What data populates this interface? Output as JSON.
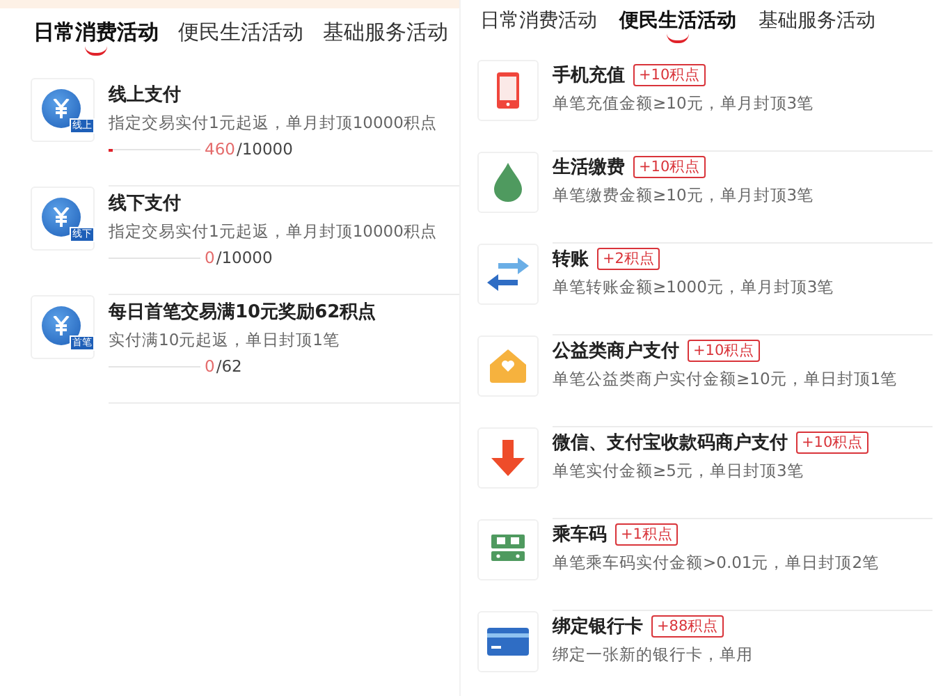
{
  "panels": [
    {
      "tabs": [
        {
          "label": "日常消费活动",
          "selected": true
        },
        {
          "label": "便民生活活动",
          "selected": false
        },
        {
          "label": "基础服务活动",
          "selected": false
        }
      ],
      "items": [
        {
          "kind": "progress",
          "tag": "线上",
          "title": "线上支付",
          "desc": "指定交易实付1元起返，单月封顶10000积点",
          "level": 0.046,
          "reading": "460",
          "limit": "/10000"
        },
        {
          "kind": "progress",
          "tag": "线下",
          "title": "线下支付",
          "desc": "指定交易实付1元起返，单月封顶10000积点",
          "reading": "0",
          "limit": "/10000"
        },
        {
          "kind": "progress",
          "tag": "首笔",
          "title": "每日首笔交易满10元奖励62积点",
          "desc": "实付满10元起返，单日封顶1笔",
          "reading": "0",
          "limit": "/62"
        }
      ]
    },
    {
      "tabs": [
        {
          "label": "日常消费活动",
          "selected": false
        },
        {
          "label": "便民生活活动",
          "selected": true
        },
        {
          "label": "基础服务活动",
          "selected": false
        }
      ],
      "items": [
        {
          "kind": "badge",
          "title": "手机充值",
          "badge": "+10积点",
          "desc": "单笔充值金额≥10元，单月封顶3笔"
        },
        {
          "kind": "badge",
          "title": "生活缴费",
          "badge": "+10积点",
          "desc": "单笔缴费金额≥10元，单月封顶3笔"
        },
        {
          "kind": "badge",
          "title": "转账",
          "badge": "+2积点",
          "desc": "单笔转账金额≥1000元，单月封顶3笔"
        },
        {
          "kind": "badge",
          "title": "公益类商户支付",
          "badge": "+10积点",
          "desc": "单笔公益类商户实付金额≥10元，单日封顶1笔"
        },
        {
          "kind": "badge",
          "title": "微信、支付宝收款码商户支付",
          "badge": "+10积点",
          "desc": "单笔实付金额≥5元，单日封顶3笔"
        },
        {
          "kind": "badge",
          "title": "乘车码",
          "badge": "+1积点",
          "desc": "单笔乘车码实付金额>0.01元，单日封顶2笔"
        },
        {
          "kind": "badge",
          "title": "绑定银行卡",
          "badge": "+88积点",
          "desc": "绑定一张新的银行卡，单用"
        }
      ]
    }
  ]
}
